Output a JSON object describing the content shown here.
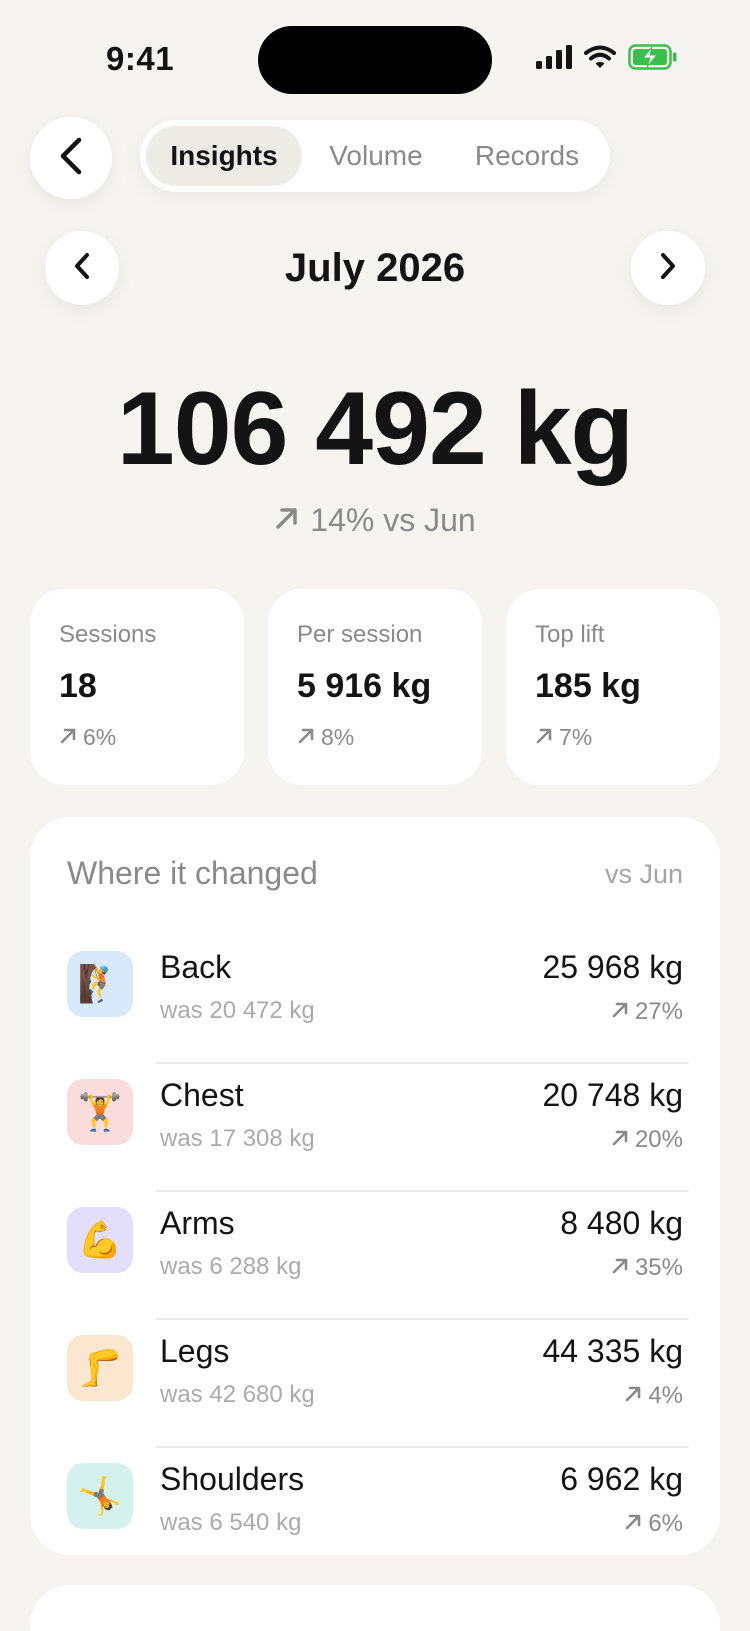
{
  "status": {
    "time": "9:41"
  },
  "header": {
    "tabs": [
      {
        "label": "Insights",
        "active": true
      },
      {
        "label": "Volume",
        "active": false
      },
      {
        "label": "Records",
        "active": false
      }
    ]
  },
  "month_nav": {
    "label": "July 2026"
  },
  "summary": {
    "total": "106 492 kg",
    "change": "14% vs Jun"
  },
  "stats": [
    {
      "label": "Sessions",
      "value": "18",
      "change": "6%"
    },
    {
      "label": "Per session",
      "value": "5 916 kg",
      "change": "8%"
    },
    {
      "label": "Top lift",
      "value": "185 kg",
      "change": "7%"
    }
  ],
  "changes": {
    "title": "Where it changed",
    "comparison": "vs Jun",
    "rows": [
      {
        "name": "Back",
        "was": "was 20 472 kg",
        "value": "25 968 kg",
        "change": "27%",
        "emoji": "🧗",
        "icon_bg": "#d8e9fb"
      },
      {
        "name": "Chest",
        "was": "was 17 308 kg",
        "value": "20 748 kg",
        "change": "20%",
        "emoji": "🏋️",
        "icon_bg": "#fbdcdc"
      },
      {
        "name": "Arms",
        "was": "was 6 288 kg",
        "value": "8 480 kg",
        "change": "35%",
        "emoji": "💪",
        "icon_bg": "#e3defa"
      },
      {
        "name": "Legs",
        "was": "was 42 680 kg",
        "value": "44 335 kg",
        "change": "4%",
        "emoji": "🦵",
        "icon_bg": "#fbe6cf"
      },
      {
        "name": "Shoulders",
        "was": "was 6 540 kg",
        "value": "6 962 kg",
        "change": "6%",
        "emoji": "🤸",
        "icon_bg": "#d5f1ee"
      }
    ]
  },
  "colors": {
    "background": "#f5f4f1",
    "card": "#ffffff",
    "text": "#141414",
    "muted": "#8a8a8a",
    "battery_green": "#3bbf4c"
  }
}
